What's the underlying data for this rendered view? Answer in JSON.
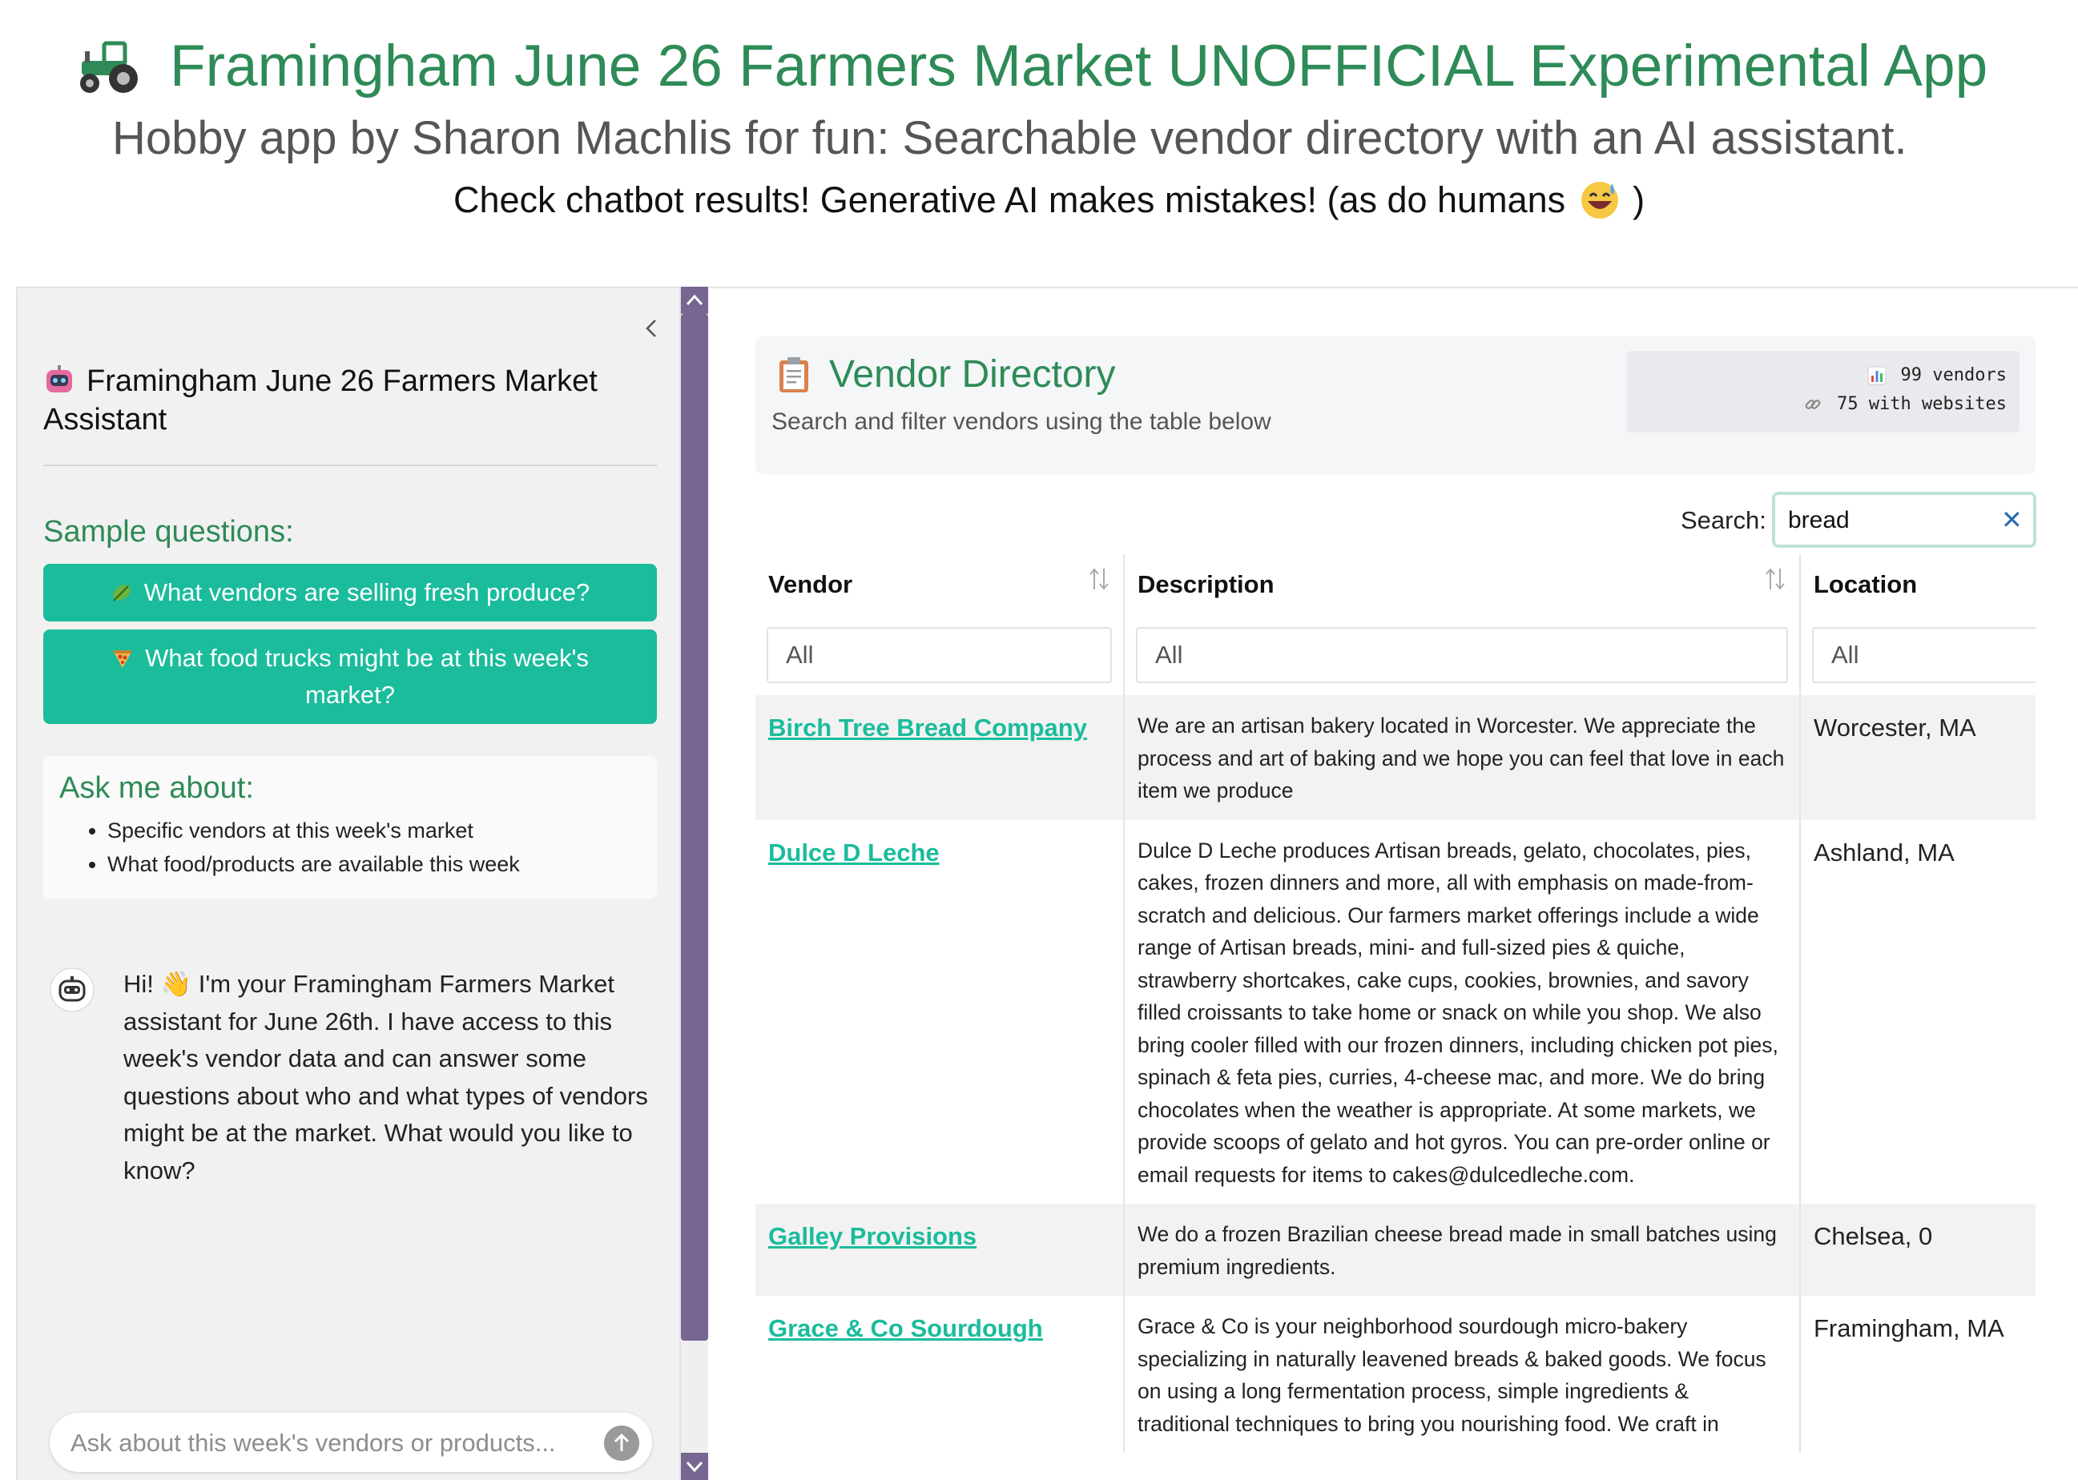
{
  "header": {
    "title": "Framingham June 26 Farmers Market UNOFFICIAL Experimental App",
    "subtitle": "Hobby app by Sharon Machlis for fun: Searchable vendor directory with an AI assistant.",
    "warning_before": "Check chatbot results! Generative AI makes mistakes! (as do humans",
    "warning_after": ")"
  },
  "sidebar": {
    "assistant_title": "Framingham June 26 Farmers Market Assistant",
    "sample_label": "Sample questions:",
    "sample_questions": [
      "What vendors are selling fresh produce?",
      "What food trucks might be at this week's market?"
    ],
    "ask_title": "Ask me about:",
    "ask_items": [
      "Specific vendors at this week's market",
      "What food/products are available this week"
    ],
    "bot_message": "Hi! 👋 I'm your Framingham Farmers Market assistant for June 26th. I have access to this week's vendor data and can answer some questions about who and what types of vendors might be at the market. What would you like to know?",
    "chat_placeholder": "Ask about this week's vendors or products..."
  },
  "directory": {
    "title": "Vendor Directory",
    "subtitle": "Search and filter vendors using the table below",
    "stats": {
      "vendors": "99 vendors",
      "websites": "75 with websites"
    },
    "search_label": "Search:",
    "search_value": "bread",
    "columns": [
      "Vendor",
      "Description",
      "Location"
    ],
    "filter_placeholder": "All",
    "rows": [
      {
        "vendor": "Birch Tree Bread Company",
        "description": "We are an artisan bakery located in Worcester. We appreciate the process and art of baking and we hope you can feel that love in each item we produce",
        "location": "Worcester, MA"
      },
      {
        "vendor": "Dulce D Leche",
        "description": "Dulce D Leche produces Artisan breads, gelato, chocolates, pies, cakes, frozen dinners and more, all with emphasis on made-from-scratch and delicious. Our farmers market offerings include a wide range of Artisan breads, mini- and full-sized pies & quiche, strawberry shortcakes, cake cups, cookies, brownies, and savory filled croissants to take home or snack on while you shop. We also bring cooler filled with our frozen dinners, including chicken pot pies, spinach & feta pies, curries, 4-cheese mac, and more. We do bring chocolates when the weather is appropriate. At some markets, we provide scoops of gelato and hot gyros. You can pre-order online or email requests for items to cakes@dulcedleche.com.",
        "location": "Ashland, MA"
      },
      {
        "vendor": "Galley Provisions",
        "description": "We do a frozen Brazilian cheese bread made in small batches using premium ingredients.",
        "location": "Chelsea, 0"
      },
      {
        "vendor": "Grace & Co Sourdough",
        "description": "Grace & Co is your neighborhood sourdough micro-bakery specializing in naturally leavened breads & baked goods. We focus on using a long fermentation process, simple ingredients & traditional techniques to bring you nourishing food. We craft in",
        "location": "Framingham, MA"
      }
    ]
  },
  "colors": {
    "accent_green": "#2e8b57",
    "button_teal": "#1abc9c",
    "scrollbar_purple": "#776592",
    "search_border": "#bfe3d3"
  },
  "icons": {
    "title": "tractor-icon",
    "warning": "grinning-sweat-emoji",
    "assistant": "robot-icon",
    "sample_1": "leafy-green-icon",
    "sample_2": "pizza-icon",
    "directory": "clipboard-icon",
    "stat_vendors": "bar-chart-icon",
    "stat_websites": "link-icon"
  }
}
